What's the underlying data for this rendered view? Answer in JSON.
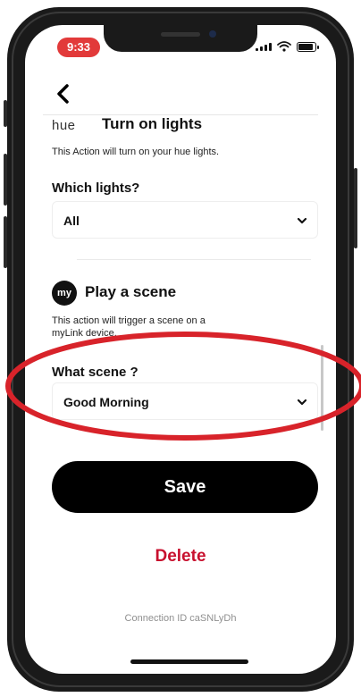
{
  "status_bar": {
    "time": "9:33"
  },
  "hue_section": {
    "logo": "hue",
    "title": "Turn on lights",
    "description": "This Action will turn on your hue lights.",
    "field_label": "Which lights?",
    "selected_value": "All"
  },
  "mylink_section": {
    "logo": "my",
    "title": "Play a scene",
    "description_line1": "This action will trigger a scene on a",
    "description_line2": "myLink device.",
    "field_label": "What scene ?",
    "selected_value": "Good Morning"
  },
  "actions": {
    "save_label": "Save",
    "delete_label": "Delete"
  },
  "footer": {
    "connection_id": "Connection ID caSNLyDh"
  },
  "colors": {
    "time_pill": "#e23a3a",
    "delete_text": "#c8102e",
    "save_button": "#000000",
    "annotation_ellipse": "#d8232a"
  }
}
